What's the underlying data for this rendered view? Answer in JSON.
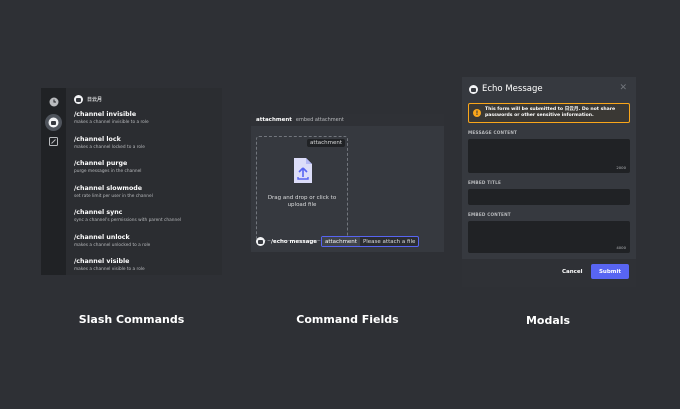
{
  "captions": {
    "slash": "Slash Commands",
    "fields": "Command Fields",
    "modals": "Modals"
  },
  "slash": {
    "bot_name": "日云月",
    "rail_icons": [
      "clock-icon",
      "bot-avatar-icon",
      "edit-icon"
    ],
    "commands": [
      {
        "name": "/channel invisible",
        "desc": "makes a channel invisible to a role"
      },
      {
        "name": "/channel lock",
        "desc": "makes a channel locked to a role"
      },
      {
        "name": "/channel purge",
        "desc": "purge messages in the channel"
      },
      {
        "name": "/channel slowmode",
        "desc": "set rate limit per user in the channel"
      },
      {
        "name": "/channel sync",
        "desc": "sync a channel's permissions with parent channel"
      },
      {
        "name": "/channel unlock",
        "desc": "makes a channel unlocked to a role"
      },
      {
        "name": "/channel visible",
        "desc": "makes a channel visible to a role"
      }
    ]
  },
  "fields": {
    "header_option": "attachment",
    "header_desc": "embed attachment",
    "drop_tag": "attachment",
    "drop_text": "Drag and drop or click to upload file",
    "command": "/echo message",
    "option_key": "attachment",
    "option_placeholder": "Please attach a file",
    "accent": "#5865f2"
  },
  "modal": {
    "title": "Echo Message",
    "close": "✕",
    "warning_icon": "!",
    "warning": "This form will be submitted to 日云月. Do not share passwords or other sensitive information.",
    "label_content": "MESSAGE CONTENT",
    "count_content": "2000",
    "label_title": "EMBED TITLE",
    "label_embed": "EMBED CONTENT",
    "count_embed": "4000",
    "cancel": "Cancel",
    "submit": "Submit",
    "warning_color": "#faa61a",
    "submit_color": "#5865f2"
  }
}
